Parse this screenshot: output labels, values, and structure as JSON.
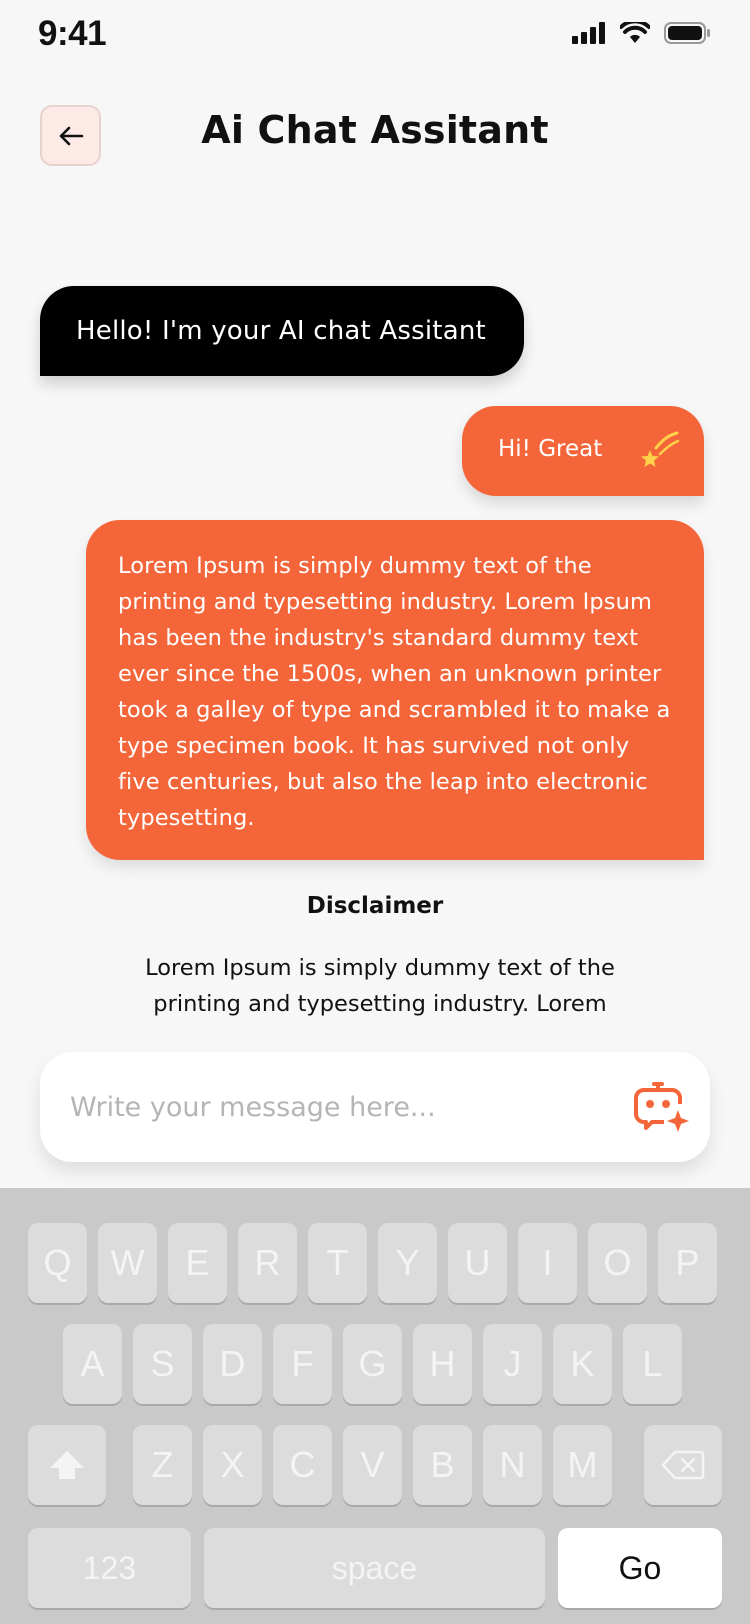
{
  "status": {
    "time": "9:41"
  },
  "header": {
    "title": "Ai Chat Assitant"
  },
  "messages": {
    "ai_greeting": "Hello! I'm your AI chat Assitant",
    "user_reply": "Hi! Great",
    "ai_long": "Lorem Ipsum is simply dummy text of the printing and typesetting industry. Lorem Ipsum has been the industry's standard dummy text ever since the 1500s, when an unknown printer took a galley of type and scrambled it to make a type specimen book. It has survived not only five centuries, but also the leap into electronic typesetting."
  },
  "disclaimer": {
    "title": "Disclaimer",
    "text": "Lorem Ipsum is simply dummy text of the printing and typesetting industry. Lorem"
  },
  "composer": {
    "placeholder": "Write your message here...",
    "icon": "bot-sparkle-icon"
  },
  "keyboard": {
    "row1": [
      "Q",
      "W",
      "E",
      "R",
      "T",
      "Y",
      "U",
      "I",
      "O",
      "P"
    ],
    "row2": [
      "A",
      "S",
      "D",
      "F",
      "G",
      "H",
      "J",
      "K",
      "L"
    ],
    "row3": [
      "Z",
      "X",
      "C",
      "V",
      "B",
      "N",
      "M"
    ],
    "numbers_label": "123",
    "space_label": "space",
    "go_label": "Go"
  },
  "colors": {
    "accent": "#f4663a",
    "dark_bubble": "#000000",
    "background": "#f7f7f7"
  }
}
